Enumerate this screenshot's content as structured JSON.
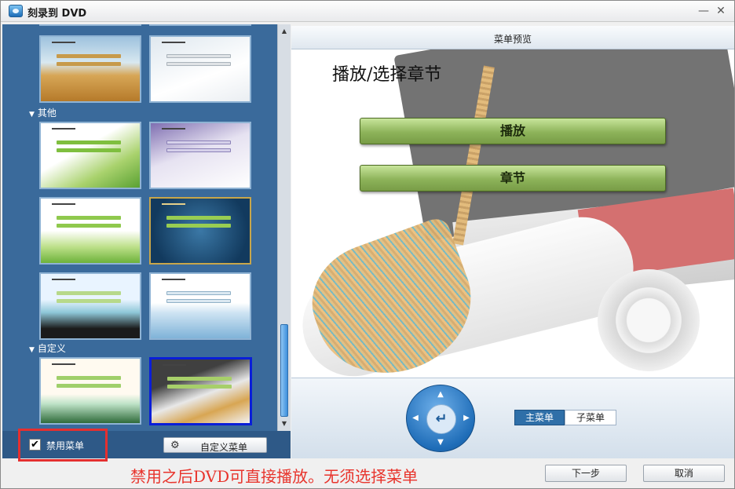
{
  "window": {
    "title": "刻录到 DVD",
    "minimize_glyph": "—",
    "close_glyph": "✕"
  },
  "template_panel": {
    "groups": [
      {
        "label": "其他"
      },
      {
        "label": "自定义"
      }
    ],
    "disable_menu_checked": true,
    "disable_menu_label": "禁用菜单",
    "custom_menu_button": "自定义菜单"
  },
  "preview": {
    "header": "菜单预览",
    "title": "播放/选择章节",
    "buttons": [
      "播放",
      "章节"
    ]
  },
  "controls": {
    "tab_main": "主菜单",
    "tab_sub": "子菜单",
    "enter_glyph": "↵"
  },
  "footer": {
    "hint": "禁用之后DVD可直接播放。无须选择菜单",
    "next": "下一步",
    "cancel": "取消"
  },
  "colors": {
    "panel_bg": "#3a6a9b",
    "selected_border": "#0a1ed8",
    "hint_red": "#e8342c",
    "highlight_red": "#e52f2f"
  }
}
